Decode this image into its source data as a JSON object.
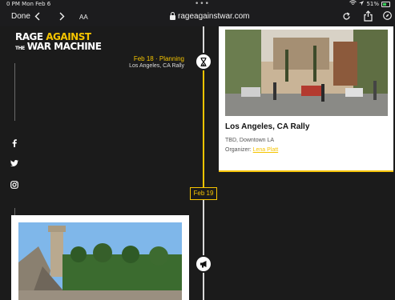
{
  "status_bar": {
    "time_date": "0 PM  Mon Feb 6",
    "battery": "51%"
  },
  "browser": {
    "done_label": "Done",
    "text_size_label": "AA",
    "url": "rageagainstwar.com"
  },
  "site": {
    "logo_line1_prefix": "RAGE ",
    "logo_line1_accent": "AGAINST",
    "logo_the": "THE",
    "logo_line2": "WAR MACHINE"
  },
  "social": [
    "facebook-icon",
    "twitter-icon",
    "instagram-icon"
  ],
  "timeline": {
    "event_top_left": {
      "category": "Feb 18 · Planning",
      "location": "Los Angeles, CA Rally"
    },
    "date_tag": "Feb 19",
    "card_right": {
      "title": "Los Angeles, CA Rally",
      "where": "TBD, Downtown LA",
      "organizer_label": "Organizer: ",
      "organizer_name": "Lena Platt"
    }
  },
  "colors": {
    "accent": "#f5c400",
    "background": "#1b1b1b",
    "card": "#ffffff"
  }
}
